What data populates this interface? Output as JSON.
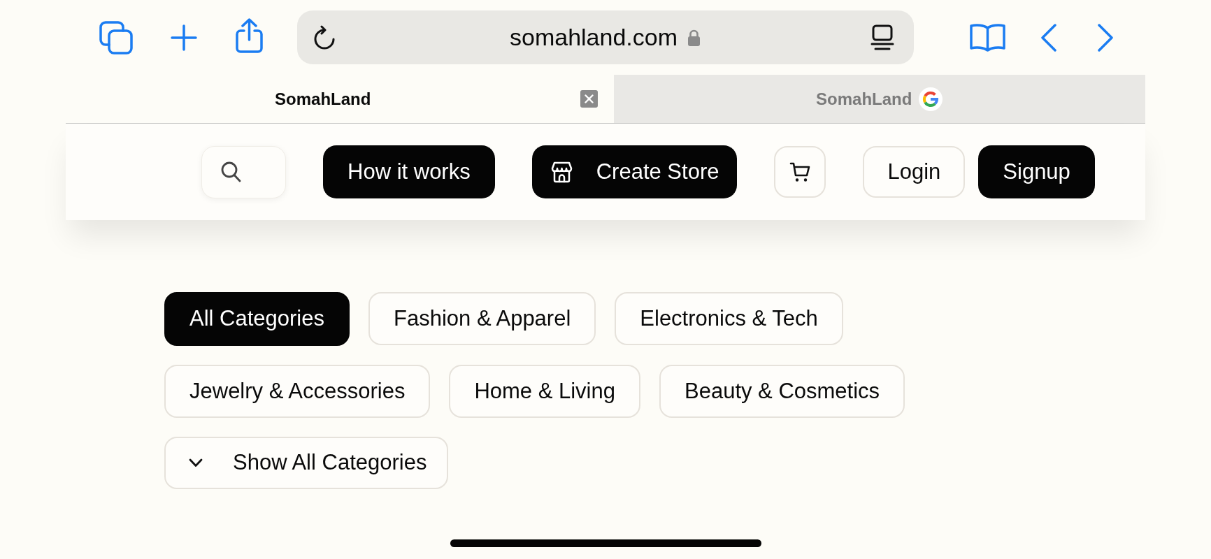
{
  "browser": {
    "url": "somahland.com"
  },
  "tabs": [
    {
      "title": "SomahLand",
      "selected": true
    },
    {
      "title": "SomahLand",
      "selected": false
    }
  ],
  "nav": {
    "items": [
      {
        "kind": "search"
      },
      {
        "kind": "primary",
        "label": "How it works"
      },
      {
        "kind": "store",
        "label": "Create Store"
      },
      {
        "kind": "cart"
      },
      {
        "kind": "secondary",
        "label": "Login"
      },
      {
        "kind": "primary",
        "label": "Signup"
      }
    ]
  },
  "categories": [
    {
      "label": "All Categories",
      "selected": true
    },
    {
      "label": "Fashion & Apparel",
      "selected": false
    },
    {
      "label": "Electronics & Tech",
      "selected": false
    },
    {
      "label": "Jewelry & Accessories",
      "selected": false
    },
    {
      "label": "Home & Living",
      "selected": false
    },
    {
      "label": "Beauty & Cosmetics",
      "selected": false
    }
  ],
  "show_all": {
    "label": "Show All Categories",
    "expanded": false
  }
}
